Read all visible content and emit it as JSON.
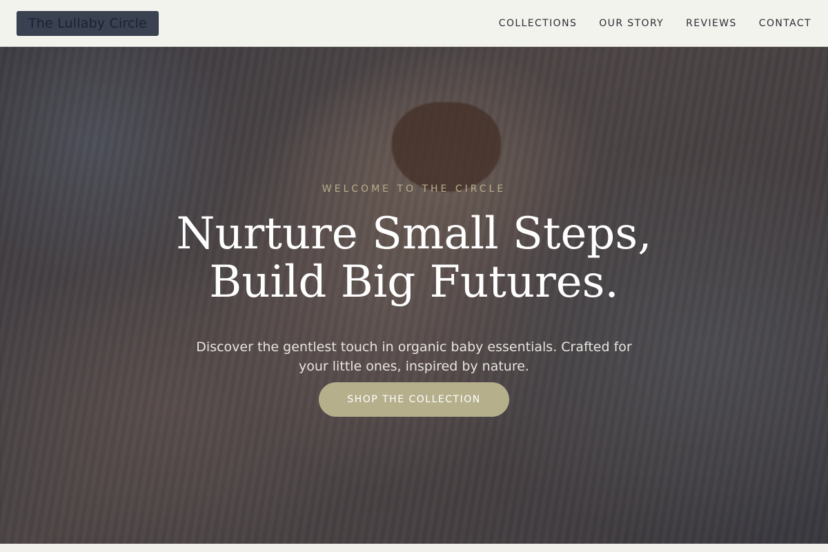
{
  "header": {
    "brand": "The Lullaby Circle",
    "nav": [
      "COLLECTIONS",
      "OUR STORY",
      "REVIEWS",
      "CONTACT"
    ]
  },
  "hero": {
    "eyebrow": "WELCOME TO THE CIRCLE",
    "headline_line1": "Nurture Small Steps,",
    "headline_line2": "Build Big Futures.",
    "subtext": "Discover the gentlest touch in organic baby essentials. Crafted for your little ones, inspired by nature.",
    "cta_label": "SHOP THE COLLECTION"
  },
  "colors": {
    "brand_bg": "#3a4150",
    "accent": "#b6af8c",
    "eyebrow": "#b9ad8b",
    "header_bg": "#f3f3ee"
  }
}
